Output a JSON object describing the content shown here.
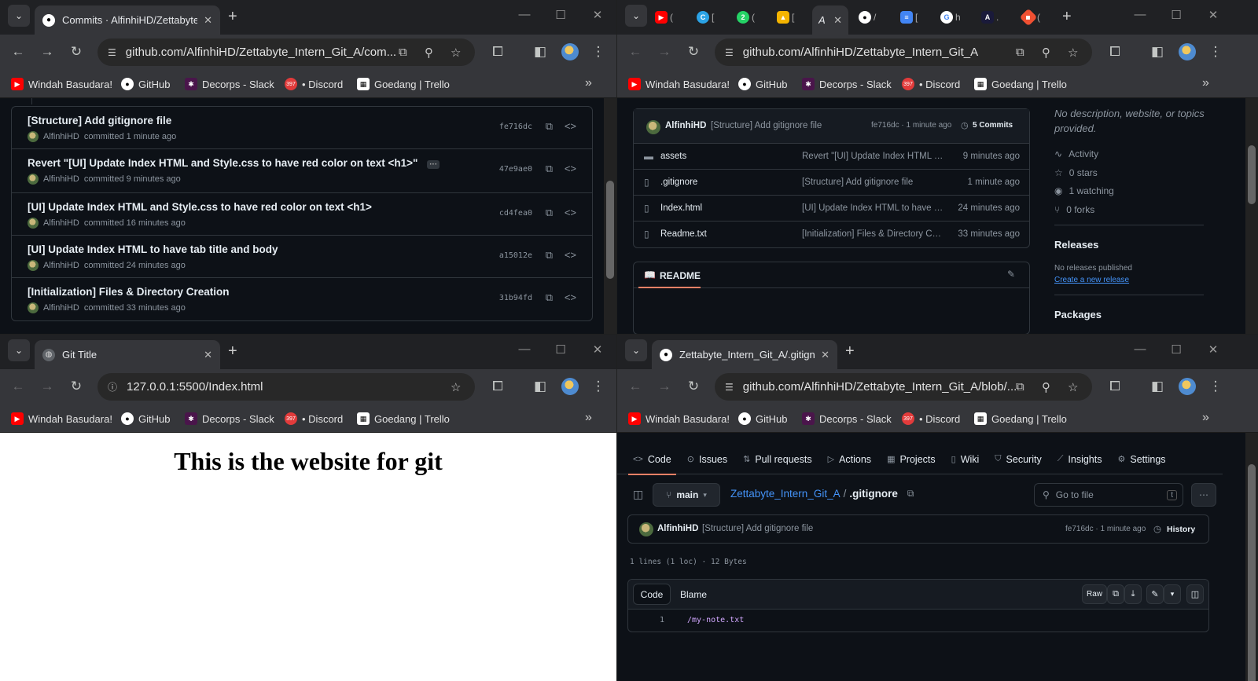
{
  "w1": {
    "tab_title": "Commits · AlfinhiHD/Zettabyte_Intern_Git_A",
    "url": "github.com/AlfinhiHD/Zettabyte_Intern_Git_A/com...",
    "commits": [
      {
        "message": "[Structure] Add gitignore file",
        "author": "AlfinhiHD",
        "when": "committed 1 minute ago",
        "sha": "fe716dc"
      },
      {
        "message": "Revert \"[UI] Update Index HTML and Style.css to have red color on text <h1>\"",
        "author": "AlfinhiHD",
        "when": "committed 9 minutes ago",
        "sha": "47e9ae0",
        "ellipsis": "···"
      },
      {
        "message": "[UI] Update Index HTML and Style.css to have red color on text <h1>",
        "author": "AlfinhiHD",
        "when": "committed 16 minutes ago",
        "sha": "cd4fea0"
      },
      {
        "message": "[UI] Update Index HTML to have tab title and body",
        "author": "AlfinhiHD",
        "when": "committed 24 minutes ago",
        "sha": "a15012e"
      },
      {
        "message": "[Initialization] Files & Directory Creation",
        "author": "AlfinhiHD",
        "when": "committed 33 minutes ago",
        "sha": "31b94fd"
      }
    ]
  },
  "bookmarks": [
    "Windah Basudara!",
    "GitHub",
    "Decorps - Slack",
    "• Discord",
    "Goedang | Trello"
  ],
  "discord_badge": "397",
  "w2": {
    "url": "github.com/AlfinhiHD/Zettabyte_Intern_Git_A",
    "tab_x": "A",
    "latest": {
      "author": "AlfinhiHD",
      "message": "[Structure] Add gitignore file",
      "meta": "fe716dc · 1 minute ago",
      "commits": "5 Commits"
    },
    "files": [
      {
        "name": "assets",
        "msg": "Revert \"[UI] Update Index HTML and Style.css to have red color on text <h1>\"",
        "time": "9 minutes ago",
        "type": "folder"
      },
      {
        "name": ".gitignore",
        "msg": "[Structure] Add gitignore file",
        "time": "1 minute ago",
        "type": "file"
      },
      {
        "name": "Index.html",
        "msg": "[UI] Update Index HTML to have tab title and body",
        "time": "24 minutes ago",
        "type": "file"
      },
      {
        "name": "Readme.txt",
        "msg": "[Initialization] Files & Directory Creation",
        "time": "33 minutes ago",
        "type": "file"
      }
    ],
    "readme": "README",
    "about": "No description, website, or topics provided.",
    "stats": [
      "Activity",
      "0 stars",
      "1 watching",
      "0 forks"
    ],
    "releases_title": "Releases",
    "releases_none": "No releases published",
    "releases_link": "Create a new release",
    "packages_title": "Packages"
  },
  "w3": {
    "tab_title": "Git Title",
    "url": "127.0.0.1:5500/Index.html",
    "heading": "This is the website for git"
  },
  "w4": {
    "tab_title": "Zettabyte_Intern_Git_A/.gitignore",
    "url": "github.com/AlfinhiHD/Zettabyte_Intern_Git_A/blob/...",
    "nav": [
      "Code",
      "Issues",
      "Pull requests",
      "Actions",
      "Projects",
      "Wiki",
      "Security",
      "Insights",
      "Settings"
    ],
    "branch": "main",
    "repo": "Zettabyte_Intern_Git_A",
    "sep": "/",
    "file": ".gitignore",
    "goto": "Go to file",
    "goto_key": "t",
    "author": "AlfinhiHD",
    "message": "[Structure] Add gitignore file",
    "meta": "fe716dc · 1 minute ago",
    "history": "History",
    "size": "1 lines (1 loc) · 12 Bytes",
    "tab_code": "Code",
    "tab_blame": "Blame",
    "raw": "Raw",
    "line_no": "1",
    "line": "/my-note.txt"
  },
  "colors": {
    "bg": "#0d1117",
    "border": "#30363d",
    "accent": "#4493f8",
    "muted": "#8d96a0"
  }
}
